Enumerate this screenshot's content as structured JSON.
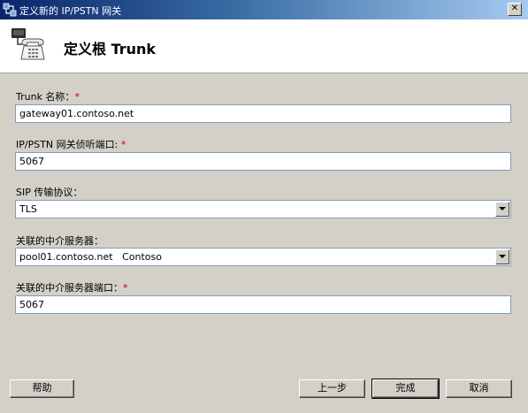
{
  "window": {
    "title": "定义新的 IP/PSTN 网关",
    "close_glyph": "✕"
  },
  "header": {
    "title": "定义根 Trunk",
    "icon": "gateway-phone-icon"
  },
  "form": {
    "trunk_name_label": "Trunk 名称：",
    "trunk_name_value": "gateway01.contoso.net",
    "listen_port_label": "IP/PSTN 网关侦听端口: ",
    "listen_port_value": "5067",
    "sip_protocol_label": "SIP 传输协议：",
    "sip_protocol_value": "TLS",
    "mediation_server_label": "关联的中介服务器：",
    "mediation_server_value": "pool01.contoso.net   Contoso",
    "mediation_port_label": "关联的中介服务器端口：",
    "mediation_port_value": "5067",
    "required_marker": "*"
  },
  "buttons": {
    "help": "帮助",
    "back": "上一步",
    "finish": "完成",
    "cancel": "取消"
  },
  "colors": {
    "title_start": "#0a246a",
    "title_end": "#a6caf0",
    "dialog_bg": "#d4d0c8",
    "required": "#c00000"
  }
}
